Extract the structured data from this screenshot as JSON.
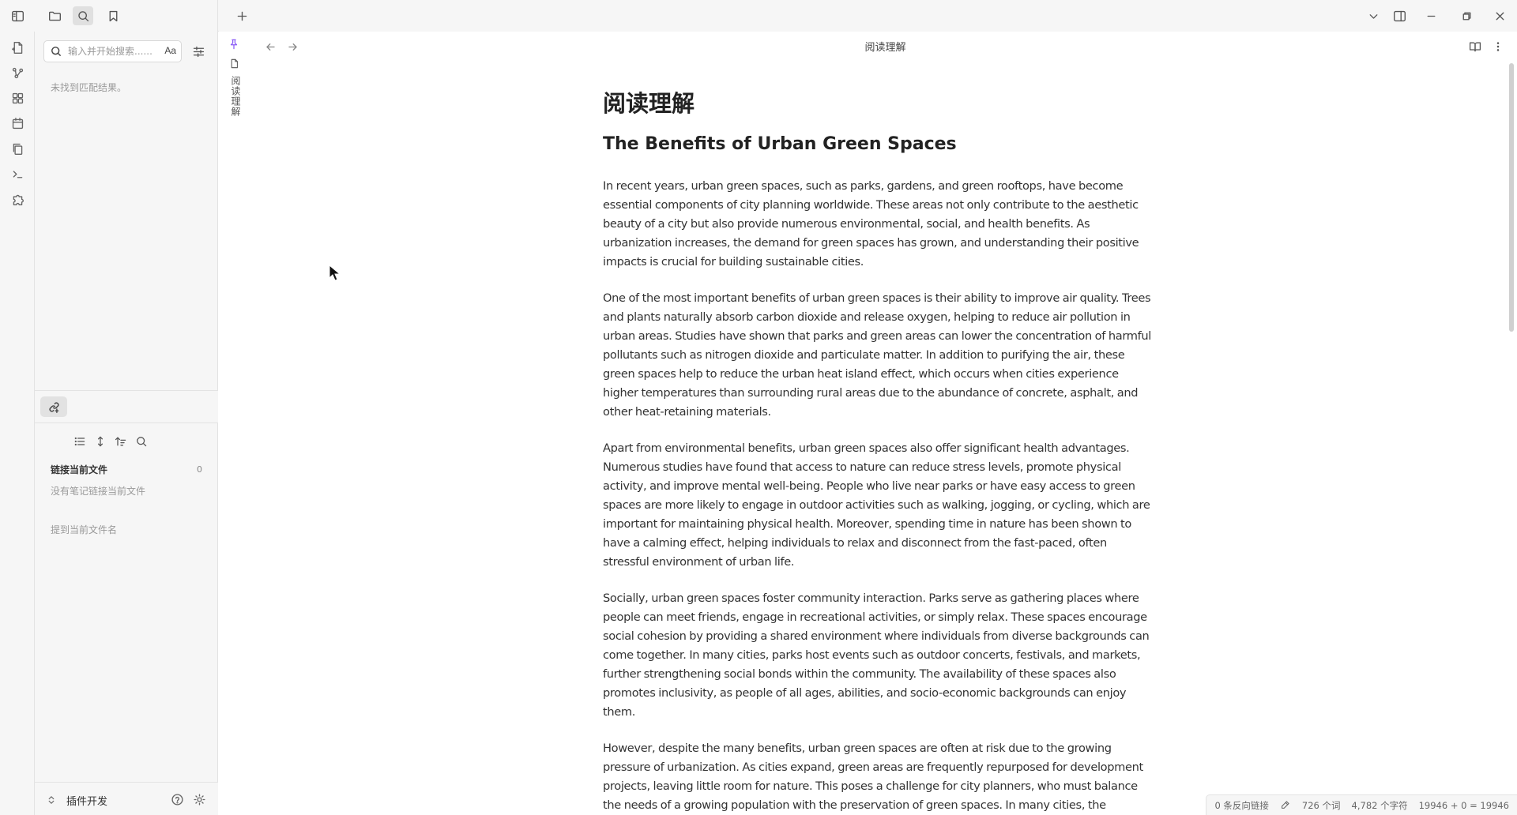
{
  "sidebar": {
    "search_placeholder": "输入并开始搜索......",
    "match_case_label": "Aa",
    "no_results": "未找到匹配结果。",
    "backlinks": {
      "linked_title": "链接当前文件",
      "linked_count": "0",
      "linked_empty": "没有笔记链接当前文件",
      "unlinked_title": "提到当前文件名"
    },
    "vault_name": "插件开发"
  },
  "tab": {
    "vertical_title": "阅读理解"
  },
  "view": {
    "title": "阅读理解"
  },
  "document": {
    "title": "阅读理解",
    "heading": "The Benefits of Urban Green Spaces",
    "paragraphs": [
      "In recent years, urban green spaces, such as parks, gardens, and green rooftops, have become essential components of city planning worldwide. These areas not only contribute to the aesthetic beauty of a city but also provide numerous environmental, social, and health benefits. As urbanization increases, the demand for green spaces has grown, and understanding their positive impacts is crucial for building sustainable cities.",
      "One of the most important benefits of urban green spaces is their ability to improve air quality. Trees and plants naturally absorb carbon dioxide and release oxygen, helping to reduce air pollution in urban areas. Studies have shown that parks and green areas can lower the concentration of harmful pollutants such as nitrogen dioxide and particulate matter. In addition to purifying the air, these green spaces help to reduce the urban heat island effect, which occurs when cities experience higher temperatures than surrounding rural areas due to the abundance of concrete, asphalt, and other heat-retaining materials.",
      "Apart from environmental benefits, urban green spaces also offer significant health advantages. Numerous studies have found that access to nature can reduce stress levels, promote physical activity, and improve mental well-being. People who live near parks or have easy access to green spaces are more likely to engage in outdoor activities such as walking, jogging, or cycling, which are important for maintaining physical health. Moreover, spending time in nature has been shown to have a calming effect, helping individuals to relax and disconnect from the fast-paced, often stressful environment of urban life.",
      "Socially, urban green spaces foster community interaction. Parks serve as gathering places where people can meet friends, engage in recreational activities, or simply relax. These spaces encourage social cohesion by providing a shared environment where individuals from diverse backgrounds can come together. In many cities, parks host events such as outdoor concerts, festivals, and markets, further strengthening social bonds within the community. The availability of these spaces also promotes inclusivity, as people of all ages, abilities, and socio-economic backgrounds can enjoy them.",
      "However, despite the many benefits, urban green spaces are often at risk due to the growing pressure of urbanization. As cities expand, green areas are frequently repurposed for development projects, leaving little room for nature. This poses a challenge for city planners, who must balance the needs of a growing population with the preservation of green spaces. In many cities, the"
    ]
  },
  "status": {
    "backlinks": "0 条反向链接",
    "words": "726 个词",
    "chars": "4,782 个字符",
    "extra": "19946 + 0 = 19946"
  },
  "icons": {
    "accent": "#8b5cf6"
  }
}
